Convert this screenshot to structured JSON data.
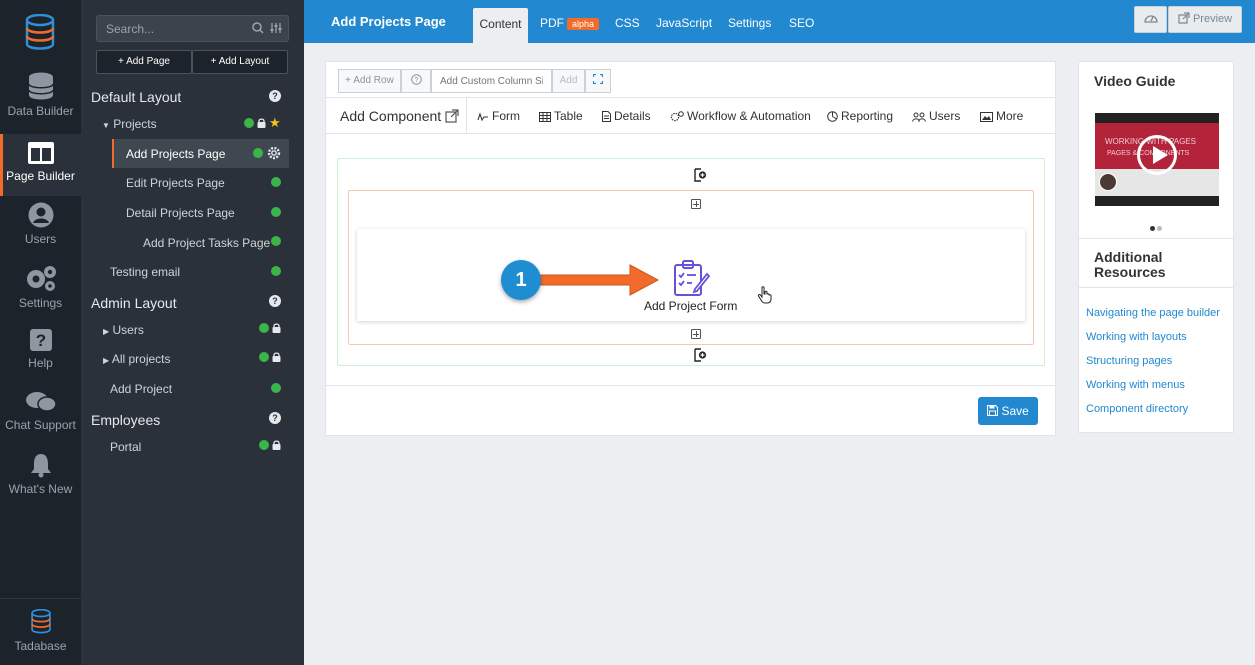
{
  "rail": {
    "items": [
      {
        "label": "Data Builder",
        "icon": "database-icon"
      },
      {
        "label": "Page Builder",
        "icon": "layout-icon"
      },
      {
        "label": "Users",
        "icon": "user-icon"
      },
      {
        "label": "Settings",
        "icon": "gear-icon"
      },
      {
        "label": "Help",
        "icon": "question-icon"
      },
      {
        "label": "Chat Support",
        "icon": "chat-icon"
      },
      {
        "label": "What's New",
        "icon": "bell-icon"
      }
    ],
    "brand": "Tadabase"
  },
  "sidebar": {
    "search_placeholder": "Search...",
    "add_page": "+ Add Page",
    "add_layout": "+ Add Layout",
    "sections": [
      {
        "title": "Default Layout"
      },
      {
        "title": "Admin Layout"
      },
      {
        "title": "Employees"
      }
    ],
    "items": [
      "Projects",
      "Add Projects Page",
      "Edit Projects Page",
      "Detail Projects Page",
      "Add Project Tasks Page",
      "Testing email",
      "Users",
      "All projects",
      "Add Project",
      "Portal"
    ]
  },
  "topbar": {
    "title": "Add Projects Page",
    "tabs": [
      "Content",
      "PDF",
      "CSS",
      "JavaScript",
      "Settings",
      "SEO"
    ],
    "pdf_badge": "alpha",
    "preview": "Preview"
  },
  "builder": {
    "add_row": "+ Add Row",
    "custom_size_placeholder": "Add Custom Column Size",
    "add": "Add",
    "add_component": "Add Component",
    "components": [
      "Form",
      "Table",
      "Details",
      "Workflow & Automation",
      "Reporting",
      "Users",
      "More"
    ],
    "component_title": "Add Project Form",
    "save": "Save",
    "step_badge": "1"
  },
  "right": {
    "video_title": "Video Guide",
    "video_text_1": "WORKING WITH PAGES",
    "video_text_2": "PAGES & COMPONENTS",
    "resources_title": "Additional Resources",
    "links": [
      "Navigating the page builder",
      "Working with layouts",
      "Structuring pages",
      "Working with menus",
      "Component directory"
    ]
  },
  "colors": {
    "accent_blue": "#2288d0",
    "accent_orange": "#f26b2a",
    "status_green": "#3ab54a",
    "sidebar_bg": "#2a313a"
  }
}
